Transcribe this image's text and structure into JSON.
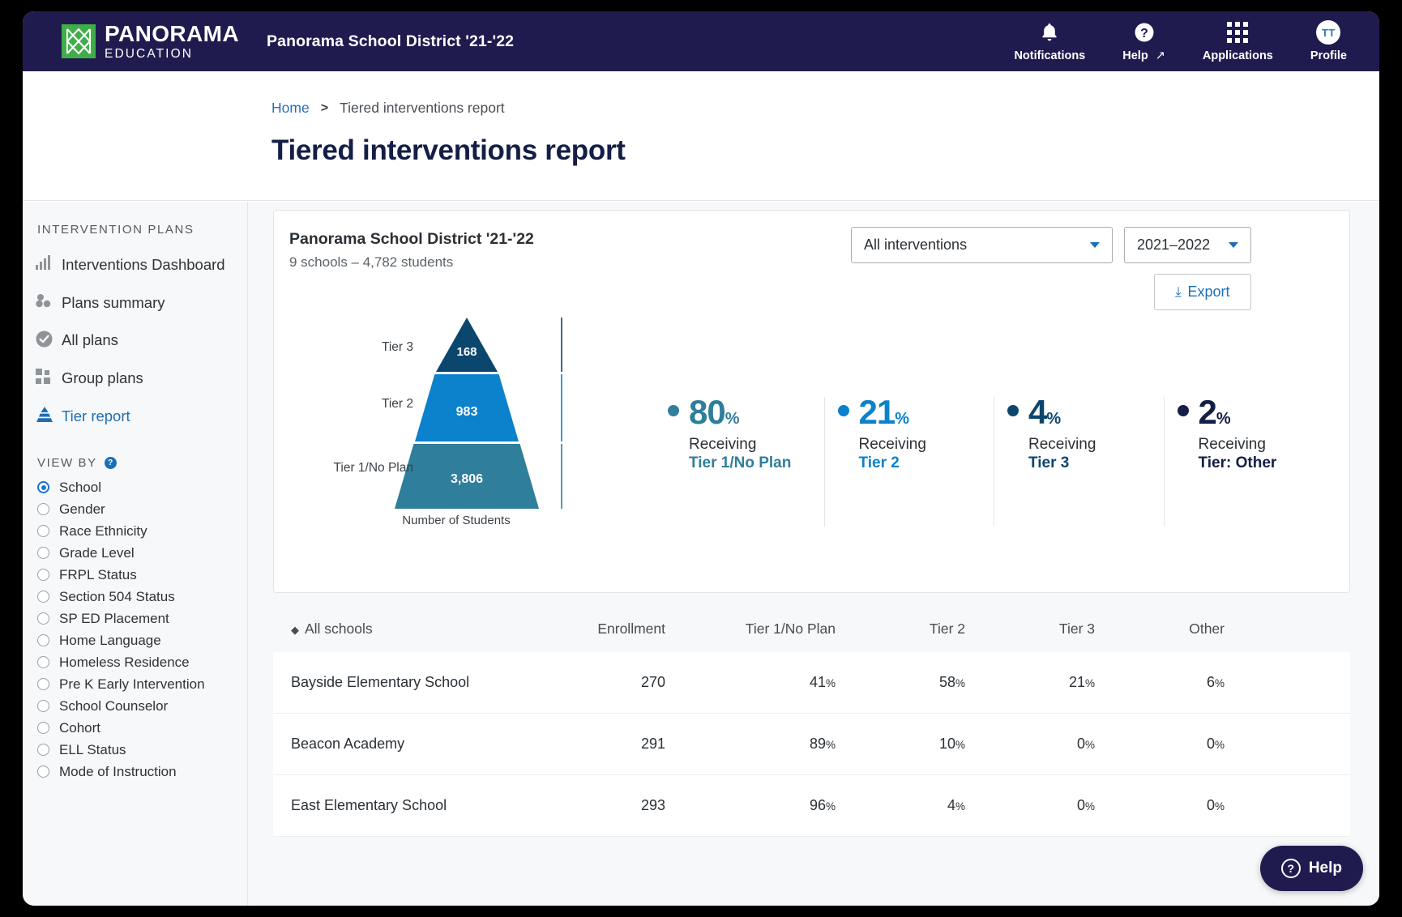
{
  "topnav": {
    "logo": {
      "line1": "PANORAMA",
      "line2": "EDUCATION",
      "color": "#3fae49"
    },
    "district": "Panorama School District '21-'22",
    "items": [
      {
        "label": "Notifications",
        "icon": "bell-icon"
      },
      {
        "label": "Help",
        "icon": "question-circle-icon"
      },
      {
        "label": "Applications",
        "icon": "grid-apps-icon"
      },
      {
        "label": "Profile",
        "icon": "avatar-icon",
        "initials": "TT"
      }
    ],
    "background": "#201b4f"
  },
  "breadcrumb": {
    "home": "Home",
    "separator": ">",
    "current": "Tiered interventions report"
  },
  "page": {
    "title": "Tiered interventions report"
  },
  "sidebar": {
    "section_label": "INTERVENTION PLANS",
    "items": [
      {
        "label": "Interventions Dashboard",
        "icon": "bar-chart-icon",
        "active": false
      },
      {
        "label": "Plans summary",
        "icon": "three-dots-icon",
        "active": false
      },
      {
        "label": "All plans",
        "icon": "check-circle-icon",
        "active": false
      },
      {
        "label": "Group plans",
        "icon": "squares-icon",
        "active": false
      },
      {
        "label": "Tier report",
        "icon": "pyramid-icon",
        "active": true
      }
    ],
    "viewby_label": "VIEW BY",
    "viewby_help": "?",
    "viewby_options": [
      {
        "label": "School",
        "selected": true
      },
      {
        "label": "Gender",
        "selected": false
      },
      {
        "label": "Race Ethnicity",
        "selected": false
      },
      {
        "label": "Grade Level",
        "selected": false
      },
      {
        "label": "FRPL Status",
        "selected": false
      },
      {
        "label": "Section 504 Status",
        "selected": false
      },
      {
        "label": "SP ED Placement",
        "selected": false
      },
      {
        "label": "Home Language",
        "selected": false
      },
      {
        "label": "Homeless Residence",
        "selected": false
      },
      {
        "label": "Pre K Early Intervention",
        "selected": false
      },
      {
        "label": "School Counselor",
        "selected": false
      },
      {
        "label": "Cohort",
        "selected": false
      },
      {
        "label": "ELL Status",
        "selected": false
      },
      {
        "label": "Mode of Instruction",
        "selected": false
      }
    ]
  },
  "card": {
    "title": "Panorama School District '21-'22",
    "subtitle": "9 schools – 4,782 students",
    "intervention_filter": "All interventions",
    "year_filter": "2021–2022",
    "export_label": "Export",
    "export_icon": "download-icon"
  },
  "chart_data": {
    "type": "pyramid",
    "title": "",
    "xlabel": "Number of Students",
    "categories": [
      "Tier 3",
      "Tier 2",
      "Tier 1/No Plan"
    ],
    "values": [
      168,
      983,
      3806
    ],
    "value_labels": [
      "168",
      "983",
      "3,806"
    ],
    "colors": [
      "#0b466e",
      "#0b82cb",
      "#2f7e9b"
    ],
    "legend": "bottom"
  },
  "stats": [
    {
      "value": "80",
      "unit": "%",
      "caption": "Receiving",
      "tier": "Tier 1/No Plan",
      "color": "#2f7e9b"
    },
    {
      "value": "21",
      "unit": "%",
      "caption": "Receiving",
      "tier": "Tier 2",
      "color": "#0b82cb"
    },
    {
      "value": "4",
      "unit": "%",
      "caption": "Receiving",
      "tier": "Tier 3",
      "color": "#0b466e"
    },
    {
      "value": "2",
      "unit": "%",
      "caption": "Receiving",
      "tier": "Tier: Other",
      "color": "#141e46"
    }
  ],
  "table": {
    "sort_icon": "sort-ascending-icon",
    "columns": [
      "All schools",
      "Enrollment",
      "Tier 1/No Plan",
      "Tier 2",
      "Tier 3",
      "Other"
    ],
    "rows": [
      {
        "school": "Bayside Elementary School",
        "enrollment": "270",
        "tier1": "41",
        "tier2": "58",
        "tier3": "21",
        "other": "6"
      },
      {
        "school": "Beacon Academy",
        "enrollment": "291",
        "tier1": "89",
        "tier2": "10",
        "tier3": "0",
        "other": "0"
      },
      {
        "school": "East Elementary School",
        "enrollment": "293",
        "tier1": "96",
        "tier2": "4",
        "tier3": "0",
        "other": "0"
      }
    ],
    "pct_symbol": "%"
  },
  "help_widget": {
    "label": "Help",
    "icon": "question-circle-icon"
  }
}
